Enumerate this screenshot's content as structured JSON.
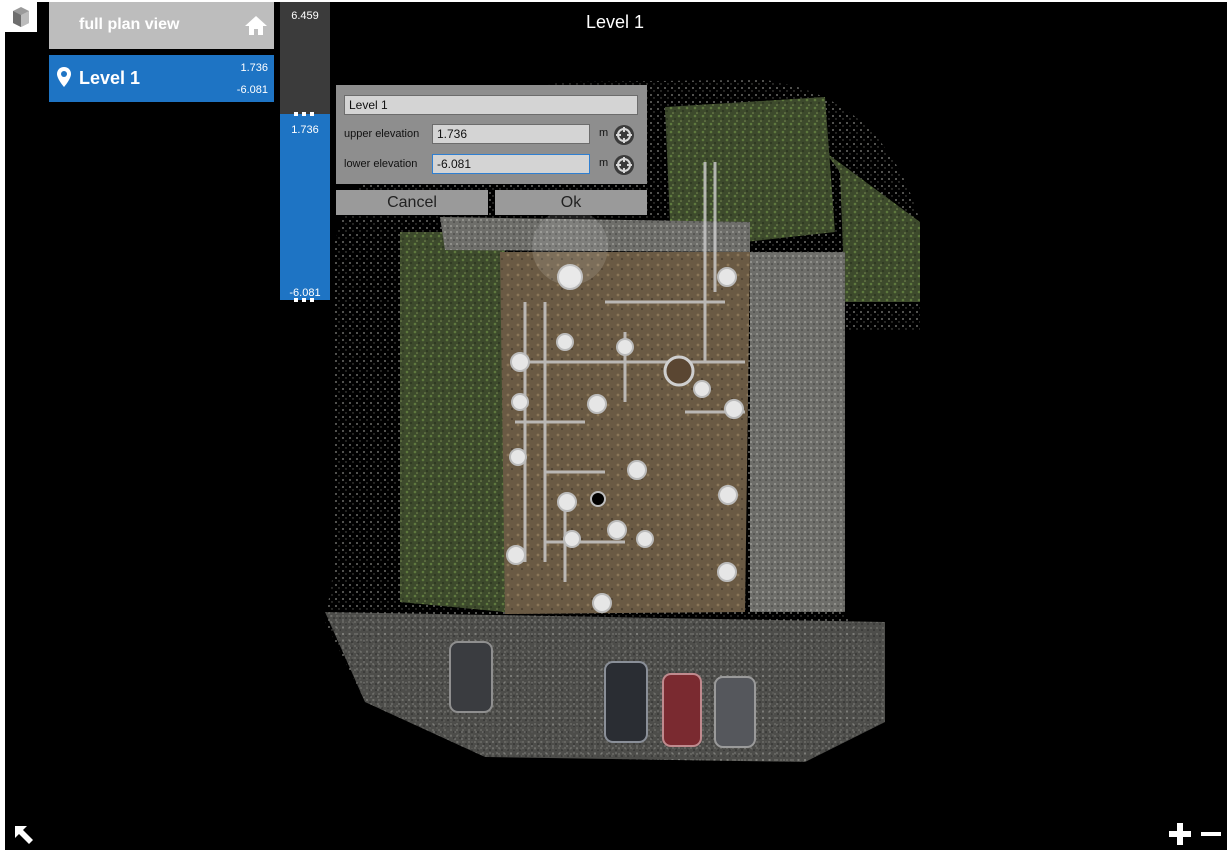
{
  "view": {
    "title": "Level 1"
  },
  "levels_panel": {
    "full_plan": {
      "label": "full plan view",
      "icon": "home-icon"
    },
    "level": {
      "label": "Level 1",
      "upper": "1.736",
      "lower": "-6.081",
      "icon": "location-pin-icon"
    }
  },
  "elevation_bar": {
    "max": "6.459",
    "upper": "1.736",
    "lower": "-6.081"
  },
  "edit_dialog": {
    "name_value": "Level 1",
    "upper_label": "upper elevation",
    "upper_value": "1.736",
    "upper_unit": "m",
    "lower_label": "lower elevation",
    "lower_value": "-6.081",
    "lower_unit": "m",
    "cancel_label": "Cancel",
    "ok_label": "Ok"
  },
  "controls": {
    "zoom_in_icon": "plus-icon",
    "zoom_out_icon": "minus-icon",
    "corner_icon": "arrow-up-left-icon"
  },
  "colors": {
    "accent": "#1e74c4",
    "panel_grey": "#bdbdbd",
    "dark": "#3b3b3b",
    "background": "#000000"
  }
}
